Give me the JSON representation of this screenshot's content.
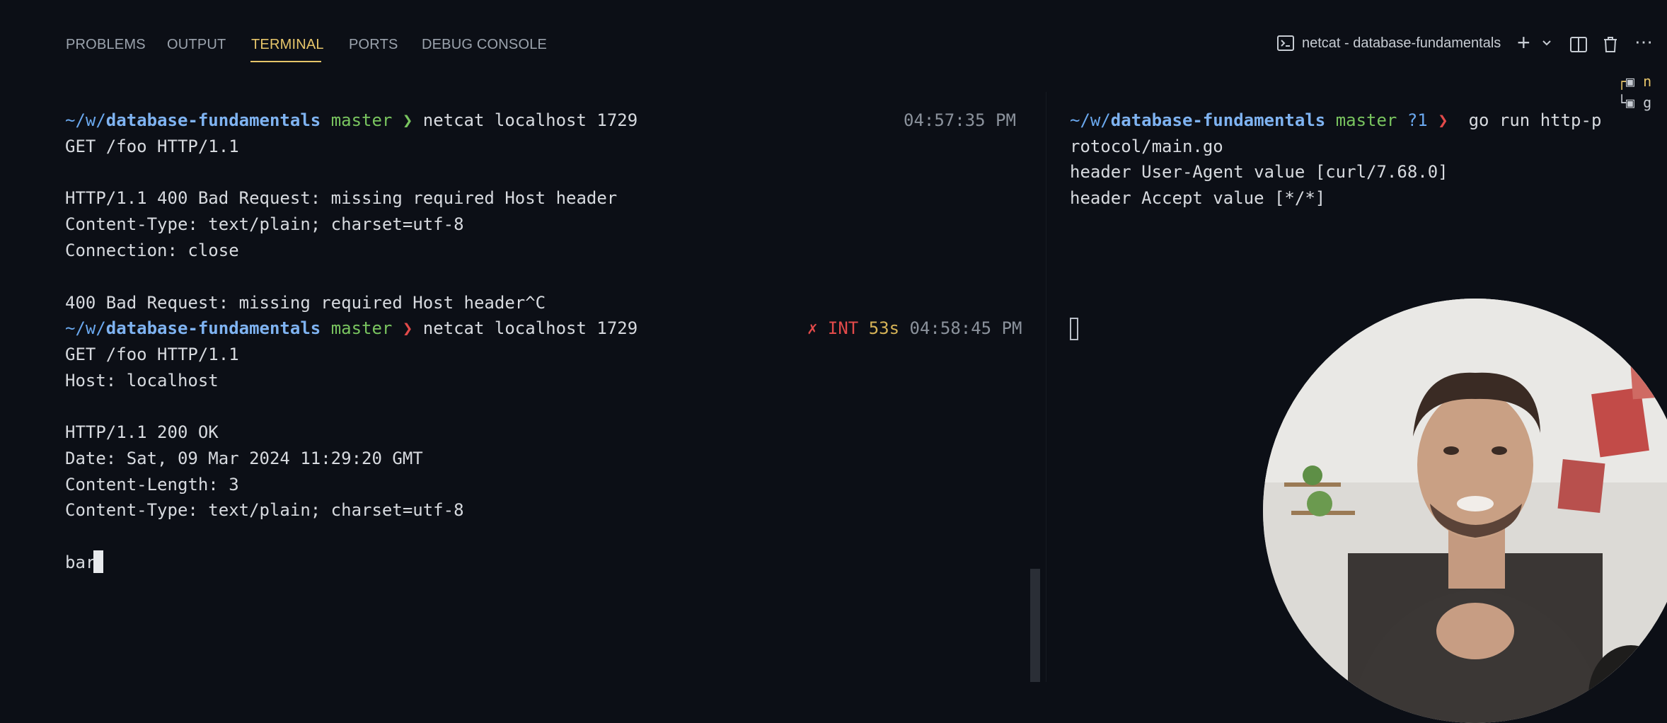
{
  "tabs": [
    {
      "label": "PROBLEMS"
    },
    {
      "label": "OUTPUT"
    },
    {
      "label": "TERMINAL"
    },
    {
      "label": "PORTS"
    },
    {
      "label": "DEBUG CONSOLE"
    }
  ],
  "toolbar": {
    "terminal_name": "netcat - database-fundamentals"
  },
  "left_terminal": {
    "prompt1": {
      "path_prefix": "~/w/",
      "path_bold": "database-fundamentals",
      "branch": "master",
      "arrow": "❯",
      "command": "netcat localhost 1729",
      "time": "04:57:35 PM"
    },
    "lines1": [
      "GET /foo HTTP/1.1",
      "",
      "HTTP/1.1 400 Bad Request: missing required Host header",
      "Content-Type: text/plain; charset=utf-8",
      "Connection: close",
      "",
      "400 Bad Request: missing required Host header^C"
    ],
    "prompt2": {
      "path_prefix": "~/w/",
      "path_bold": "database-fundamentals",
      "branch": "master",
      "arrow": "❯",
      "command": "netcat localhost 1729",
      "status_mark": "✗",
      "status": "INT",
      "duration": "53s",
      "time": "04:58:45 PM"
    },
    "lines2": [
      "GET /foo HTTP/1.1",
      "Host: localhost",
      "",
      "HTTP/1.1 200 OK",
      "Date: Sat, 09 Mar 2024 11:29:20 GMT",
      "Content-Length: 3",
      "Content-Type: text/plain; charset=utf-8",
      "",
      "bar"
    ]
  },
  "right_terminal": {
    "path_prefix": "~/w/",
    "path_bold": "database-fundamentals",
    "branch": "master",
    "status": "?1",
    "arrow": "❯",
    "command": "go run http-p",
    "lines": [
      "rotocol/main.go",
      "header User-Agent value [curl/7.68.0]",
      "header Accept value [*/*]"
    ]
  },
  "side_list": [
    {
      "label": "n"
    },
    {
      "label": "g"
    }
  ],
  "colors": {
    "background": "#0c0f16",
    "accent": "#e6c56a",
    "path": "#6aa8ee",
    "branch": "#79c45f",
    "error": "#e24a4a"
  }
}
